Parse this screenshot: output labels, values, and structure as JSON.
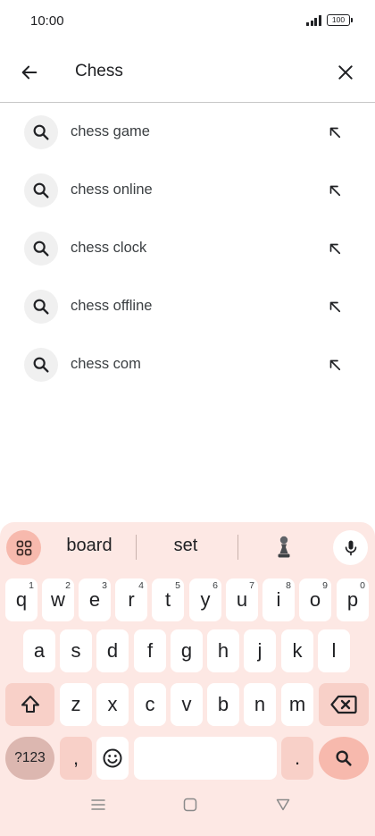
{
  "status_bar": {
    "time": "10:00",
    "battery": "100"
  },
  "search": {
    "query": "Chess"
  },
  "suggestions": [
    "chess game",
    "chess online",
    "chess clock",
    "chess offline",
    "chess com"
  ],
  "keyboard": {
    "predictions": [
      "board",
      "set"
    ],
    "row1": [
      {
        "k": "q",
        "n": "1"
      },
      {
        "k": "w",
        "n": "2"
      },
      {
        "k": "e",
        "n": "3"
      },
      {
        "k": "r",
        "n": "4"
      },
      {
        "k": "t",
        "n": "5"
      },
      {
        "k": "y",
        "n": "6"
      },
      {
        "k": "u",
        "n": "7"
      },
      {
        "k": "i",
        "n": "8"
      },
      {
        "k": "o",
        "n": "9"
      },
      {
        "k": "p",
        "n": "0"
      }
    ],
    "row2": [
      "a",
      "s",
      "d",
      "f",
      "g",
      "h",
      "j",
      "k",
      "l"
    ],
    "row3": [
      "z",
      "x",
      "c",
      "v",
      "b",
      "n",
      "m"
    ],
    "symbols_label": "?123",
    "comma": ",",
    "period": "."
  },
  "colors": {
    "keyboard_bg": "#fde8e4",
    "accent": "#f7b9ad",
    "key_bg": "#ffffff"
  }
}
